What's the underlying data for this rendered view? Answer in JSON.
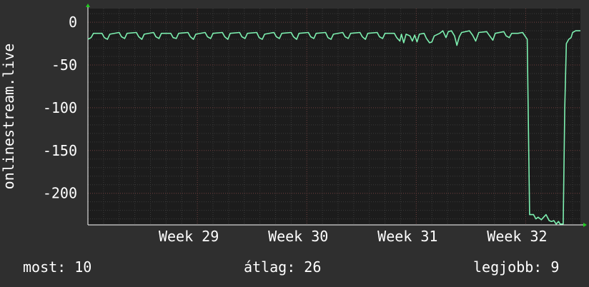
{
  "chart_data": {
    "type": "line",
    "title": "",
    "ylabel": "onlinestream.live",
    "xlabel": "",
    "ylim": [
      -237,
      16
    ],
    "y_ticks": [
      0,
      -50,
      -100,
      -150,
      -200
    ],
    "x_tick_labels": [
      "Week 29",
      "Week 30",
      "Week 31",
      "Week 32"
    ],
    "x_tick_positions_days": [
      7,
      14,
      21,
      28
    ],
    "x_range_days": [
      0,
      31.5
    ],
    "grid": true,
    "series": [
      {
        "name": "",
        "color": "#7df0b0",
        "points": [
          [
            0.0,
            -20
          ],
          [
            0.2,
            -18
          ],
          [
            0.35,
            -13
          ],
          [
            0.9,
            -13
          ],
          [
            1.05,
            -18
          ],
          [
            1.25,
            -20
          ],
          [
            1.4,
            -14
          ],
          [
            2.0,
            -12
          ],
          [
            2.15,
            -17
          ],
          [
            2.35,
            -19
          ],
          [
            2.5,
            -13
          ],
          [
            3.1,
            -12
          ],
          [
            3.25,
            -17
          ],
          [
            3.45,
            -20
          ],
          [
            3.6,
            -14
          ],
          [
            4.2,
            -12
          ],
          [
            4.35,
            -17
          ],
          [
            4.55,
            -19
          ],
          [
            4.7,
            -13
          ],
          [
            5.3,
            -13
          ],
          [
            5.45,
            -18
          ],
          [
            5.65,
            -19
          ],
          [
            5.8,
            -13
          ],
          [
            6.4,
            -12
          ],
          [
            6.55,
            -17
          ],
          [
            6.75,
            -20
          ],
          [
            6.9,
            -14
          ],
          [
            7.5,
            -12
          ],
          [
            7.65,
            -17
          ],
          [
            7.85,
            -19
          ],
          [
            8.0,
            -13
          ],
          [
            8.6,
            -12
          ],
          [
            8.75,
            -17
          ],
          [
            8.95,
            -20
          ],
          [
            9.1,
            -13
          ],
          [
            9.7,
            -12
          ],
          [
            9.85,
            -17
          ],
          [
            10.05,
            -19
          ],
          [
            10.2,
            -13
          ],
          [
            10.8,
            -12
          ],
          [
            10.95,
            -18
          ],
          [
            11.15,
            -20
          ],
          [
            11.3,
            -14
          ],
          [
            11.9,
            -12
          ],
          [
            12.05,
            -17
          ],
          [
            12.25,
            -19
          ],
          [
            12.4,
            -13
          ],
          [
            13.0,
            -12
          ],
          [
            13.15,
            -17
          ],
          [
            13.35,
            -20
          ],
          [
            13.5,
            -13
          ],
          [
            14.1,
            -12
          ],
          [
            14.25,
            -17
          ],
          [
            14.45,
            -19
          ],
          [
            14.6,
            -13
          ],
          [
            15.2,
            -12
          ],
          [
            15.35,
            -18
          ],
          [
            15.55,
            -20
          ],
          [
            15.7,
            -14
          ],
          [
            16.3,
            -12
          ],
          [
            16.45,
            -17
          ],
          [
            16.65,
            -19
          ],
          [
            16.8,
            -13
          ],
          [
            17.4,
            -12
          ],
          [
            17.55,
            -17
          ],
          [
            17.75,
            -20
          ],
          [
            17.9,
            -13
          ],
          [
            18.5,
            -12
          ],
          [
            18.65,
            -17
          ],
          [
            18.85,
            -19
          ],
          [
            19.0,
            -13
          ],
          [
            19.6,
            -13
          ],
          [
            19.75,
            -18
          ],
          [
            19.95,
            -22
          ],
          [
            20.05,
            -14
          ],
          [
            20.2,
            -24
          ],
          [
            20.35,
            -14
          ],
          [
            20.6,
            -16
          ],
          [
            20.75,
            -22
          ],
          [
            20.9,
            -15
          ],
          [
            21.05,
            -23
          ],
          [
            21.2,
            -14
          ],
          [
            21.5,
            -13
          ],
          [
            21.65,
            -19
          ],
          [
            21.85,
            -24
          ],
          [
            22.0,
            -23
          ],
          [
            22.15,
            -16
          ],
          [
            22.5,
            -13
          ],
          [
            22.7,
            -10
          ],
          [
            22.9,
            -18
          ],
          [
            23.05,
            -11
          ],
          [
            23.25,
            -10
          ],
          [
            23.45,
            -16
          ],
          [
            23.6,
            -27
          ],
          [
            23.75,
            -17
          ],
          [
            23.9,
            -12
          ],
          [
            24.4,
            -10
          ],
          [
            24.6,
            -15
          ],
          [
            24.8,
            -22
          ],
          [
            25.0,
            -12
          ],
          [
            25.5,
            -11
          ],
          [
            25.7,
            -16
          ],
          [
            25.9,
            -21
          ],
          [
            26.05,
            -13
          ],
          [
            26.6,
            -11
          ],
          [
            26.75,
            -16
          ],
          [
            26.95,
            -18
          ],
          [
            27.1,
            -13
          ],
          [
            27.5,
            -13
          ],
          [
            27.8,
            -12
          ],
          [
            28.1,
            -20
          ],
          [
            28.25,
            -225
          ],
          [
            28.5,
            -225
          ],
          [
            28.65,
            -230
          ],
          [
            28.8,
            -228
          ],
          [
            29.0,
            -231
          ],
          [
            29.15,
            -228
          ],
          [
            29.3,
            -225
          ],
          [
            29.5,
            -232
          ],
          [
            29.65,
            -233
          ],
          [
            29.8,
            -232
          ],
          [
            29.95,
            -236
          ],
          [
            30.1,
            -233
          ],
          [
            30.2,
            -236
          ],
          [
            30.4,
            -236
          ],
          [
            30.5,
            -100
          ],
          [
            30.6,
            -25
          ],
          [
            30.75,
            -20
          ],
          [
            30.9,
            -18
          ],
          [
            31.0,
            -12
          ],
          [
            31.2,
            -10
          ],
          [
            31.5,
            -10
          ]
        ]
      }
    ]
  },
  "footer": {
    "current_label": "most: 10",
    "average_label": "átlag: 26",
    "best_label": "legjobb: 9"
  }
}
